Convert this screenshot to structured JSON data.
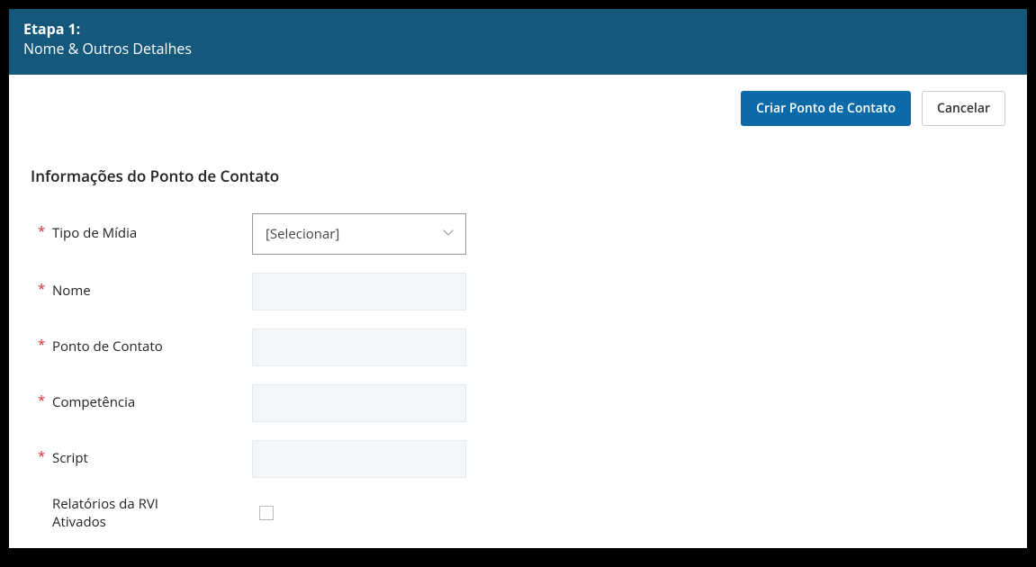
{
  "header": {
    "step": "Etapa 1:",
    "subtitle": "Nome & Outros Detalhes"
  },
  "actions": {
    "create_label": "Criar Ponto de Contato",
    "cancel_label": "Cancelar"
  },
  "section": {
    "title": "Informações do Ponto de Contato"
  },
  "form": {
    "media_type": {
      "label": "Tipo de Mídia",
      "placeholder": "[Selecionar]"
    },
    "name": {
      "label": "Nome",
      "value": ""
    },
    "point_of_contact": {
      "label": "Ponto de Contato",
      "value": ""
    },
    "competency": {
      "label": "Competência",
      "value": ""
    },
    "script": {
      "label": "Script",
      "value": ""
    },
    "rvi_reports": {
      "label": "Relatórios da RVI Ativados",
      "checked": false
    }
  }
}
